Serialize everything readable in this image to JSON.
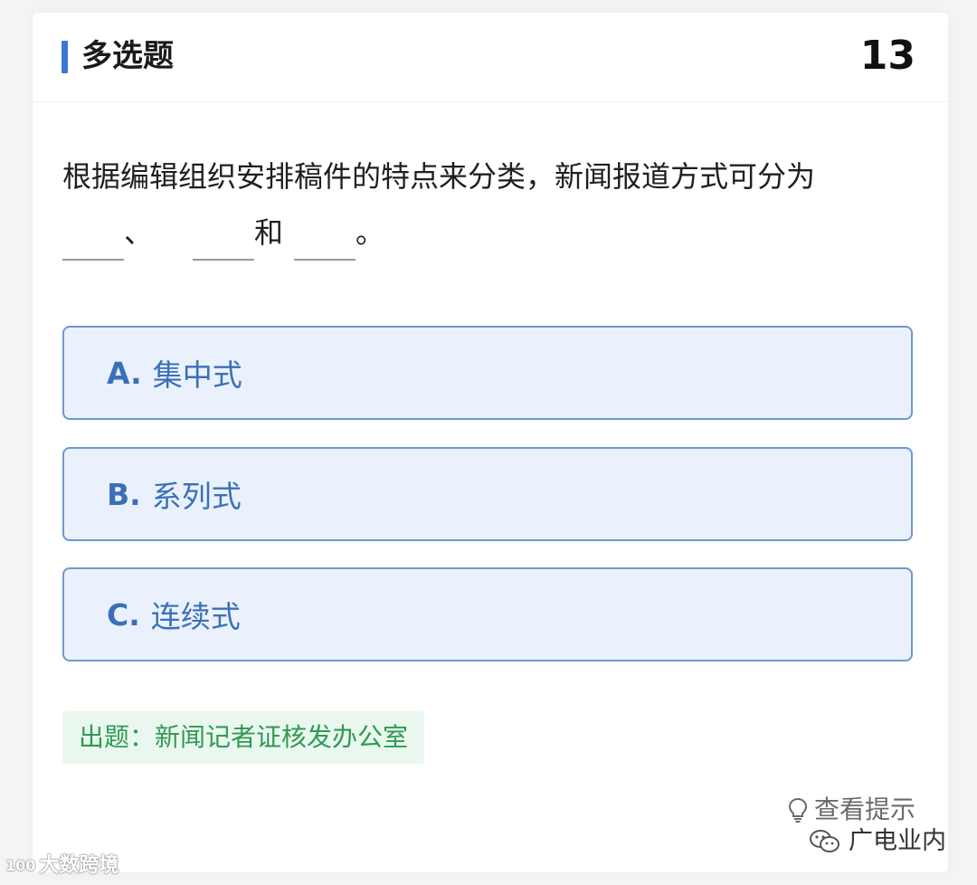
{
  "header": {
    "question_type": "多选题",
    "question_number": "13"
  },
  "question": {
    "line1": "根据编辑组织安排稿件的特点来分类，新闻报道方式可分为",
    "sep1": "、",
    "sep2": "和",
    "end": "。"
  },
  "options": [
    {
      "letter": "A.",
      "text": "集中式"
    },
    {
      "letter": "B.",
      "text": "系列式"
    },
    {
      "letter": "C.",
      "text": "连续式"
    }
  ],
  "source": "出题：新闻记者证核发办公室",
  "hint_label": "查看提示",
  "watermarks": {
    "right": "广电业内",
    "left_logo": "100",
    "left": "大数跨境"
  },
  "colors": {
    "accent": "#3e78d6",
    "option_bg": "#eaf1fc",
    "option_border": "#6f98cf",
    "option_text": "#3b6fb8",
    "source_bg": "#eaf7ee",
    "source_text": "#2f9a54"
  }
}
